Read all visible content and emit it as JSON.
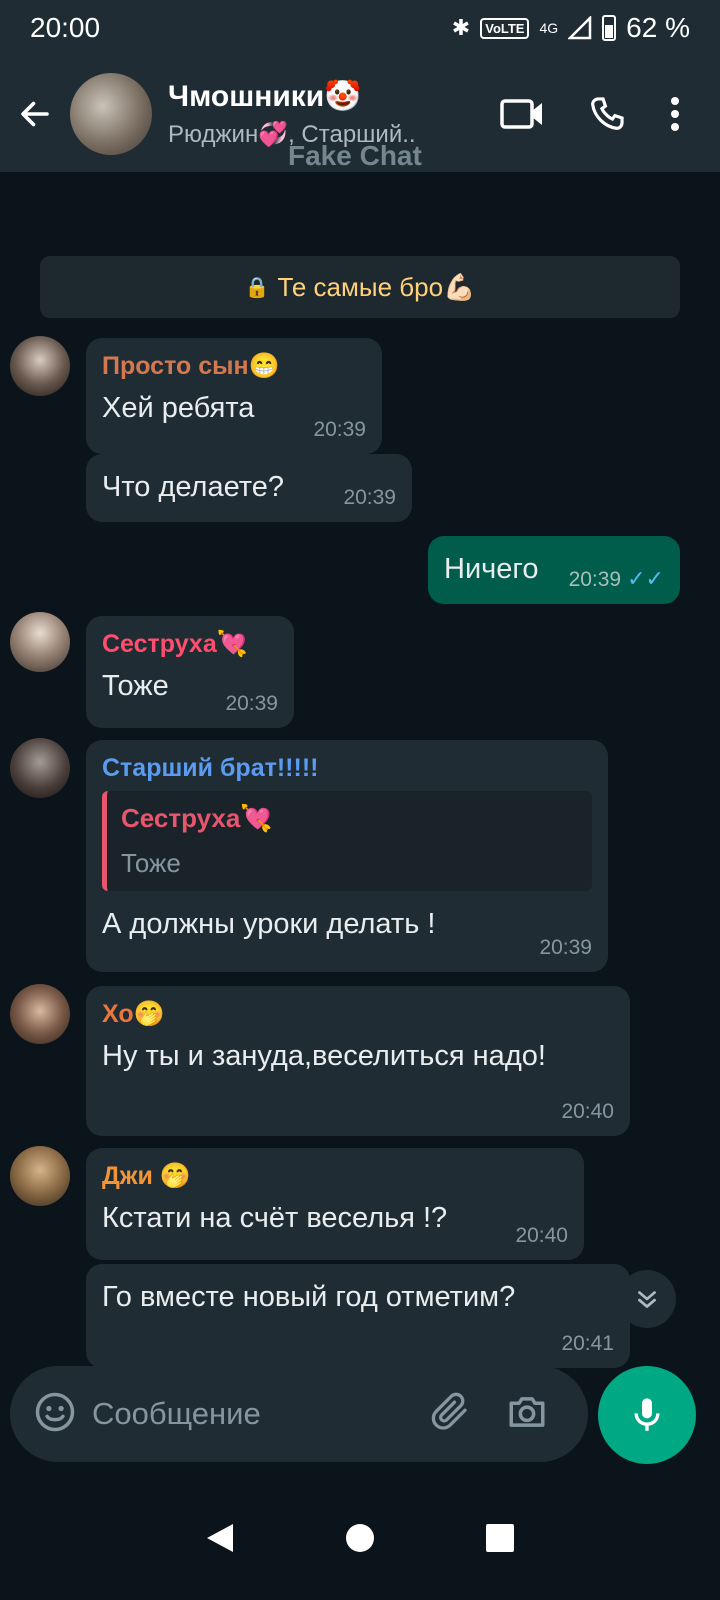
{
  "status": {
    "time": "20:00",
    "volte": "VoLTE",
    "network": "4G",
    "battery": "62 %"
  },
  "header": {
    "title": "Чмошники🤡",
    "subtitle": "Рюджин💞, Старший..",
    "watermark": "Fake Chat"
  },
  "banner": {
    "text": "Те самые бро💪🏻"
  },
  "messages": [
    {
      "sender": "Просто сын😁",
      "text": "Хей ребята",
      "time": "20:39"
    },
    {
      "text": "Что делаете?",
      "time": "20:39"
    },
    {
      "text": "Ничего",
      "time": "20:39",
      "ticks": "✓✓"
    },
    {
      "sender": "Сеструха💘",
      "text": "Тоже",
      "time": "20:39"
    },
    {
      "sender": "Старший брат!!!!!",
      "quote_name": "Сеструха💘",
      "quote_text": "Тоже",
      "text": "А должны уроки делать !",
      "time": "20:39"
    },
    {
      "sender": "Хо🤭",
      "text": "Ну ты и зануда,веселиться надо!",
      "time": "20:40"
    },
    {
      "sender": "Джи 🤭",
      "text": "Кстати на счёт веселья !?",
      "time": "20:40"
    },
    {
      "text": "Го вместе новый год отметим?",
      "time": "20:41"
    }
  ],
  "composer": {
    "placeholder": "Сообщение"
  },
  "colors": {
    "sender_1": "#d4794f",
    "sender_2": "#ff4d6d",
    "sender_3": "#5b9bf0",
    "sender_4": "#e9763b",
    "sender_5": "#f29438",
    "outgoing": "#005c4b",
    "accent": "#00a884"
  }
}
